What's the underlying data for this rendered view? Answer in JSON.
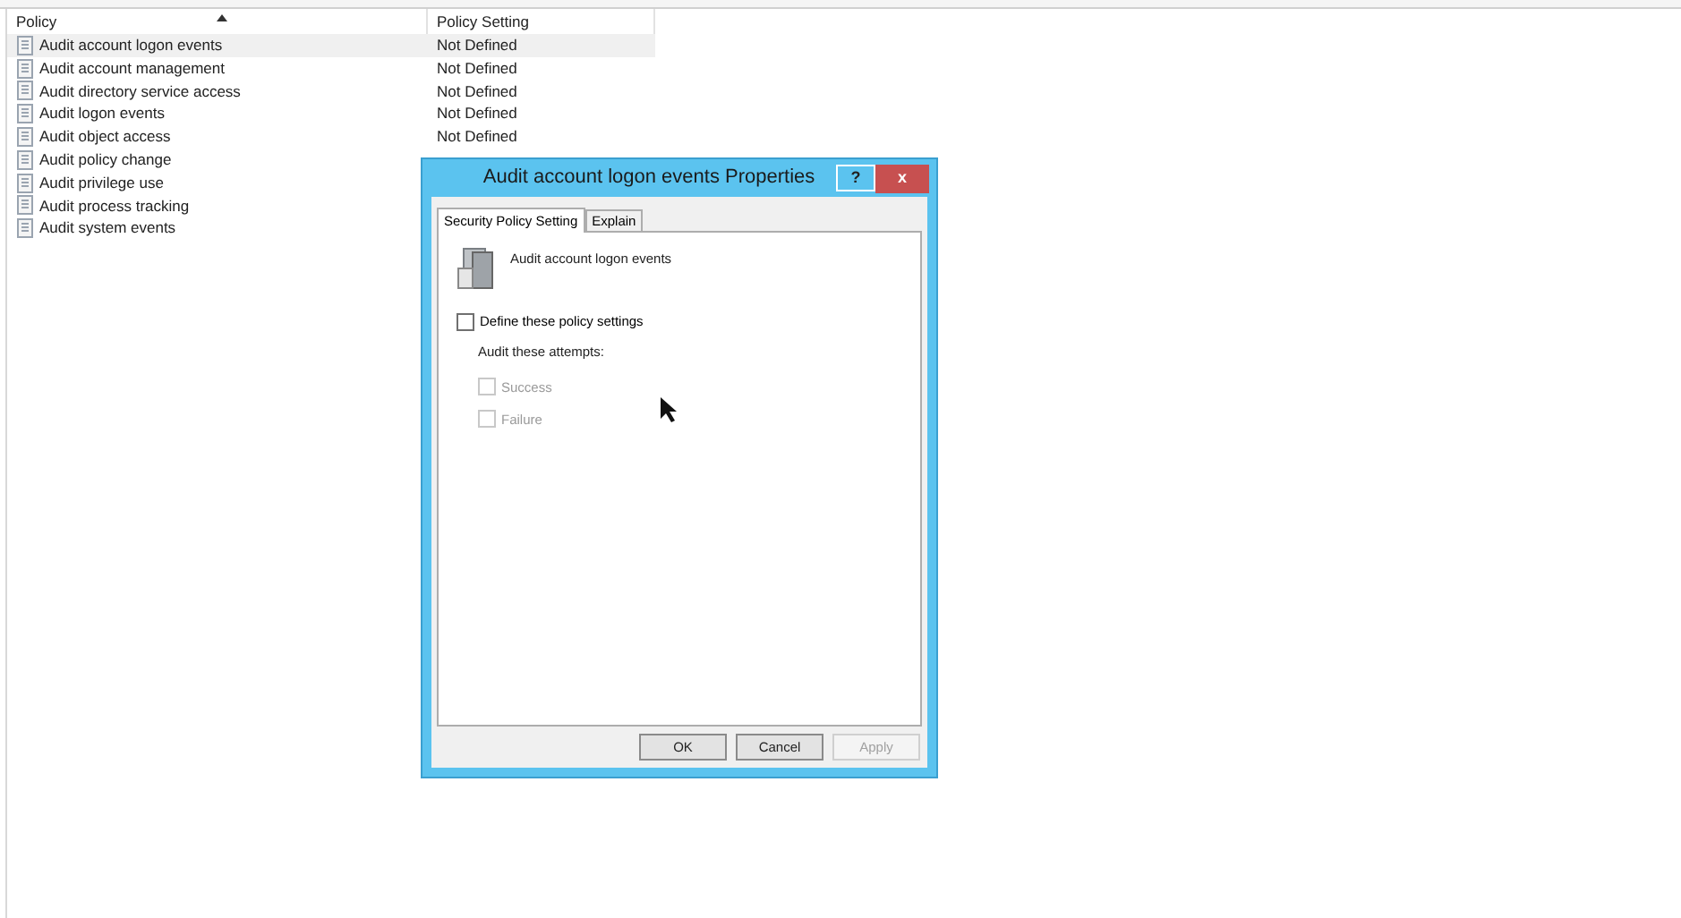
{
  "table": {
    "columns": [
      {
        "label": "Policy",
        "sorted": true
      },
      {
        "label": "Policy Setting",
        "sorted": false
      }
    ],
    "rows": [
      {
        "policy": "Audit account logon events",
        "setting": "Not Defined",
        "selected": true
      },
      {
        "policy": "Audit account management",
        "setting": "Not Defined",
        "selected": false
      },
      {
        "policy": "Audit directory service access",
        "setting": "Not Defined",
        "selected": false
      },
      {
        "policy": "Audit logon events",
        "setting": "Not Defined",
        "selected": false
      },
      {
        "policy": "Audit object access",
        "setting": "Not Defined",
        "selected": false
      },
      {
        "policy": "Audit policy change",
        "selected": false
      },
      {
        "policy": "Audit privilege use",
        "selected": false
      },
      {
        "policy": "Audit process tracking",
        "selected": false
      },
      {
        "policy": "Audit system events",
        "selected": false
      }
    ]
  },
  "dialog": {
    "title": "Audit account logon events Properties",
    "help": "?",
    "close": "x",
    "tabs": [
      {
        "label": "Security Policy Setting",
        "selected": true
      },
      {
        "label": "Explain",
        "selected": false
      }
    ],
    "policy_name": "Audit account logon events",
    "define": {
      "label": "Define these policy settings",
      "checked": false,
      "disabled": false
    },
    "attempts_label": "Audit these attempts:",
    "attempts": [
      {
        "label": "Success",
        "checked": false,
        "disabled": true
      },
      {
        "label": "Failure",
        "checked": false,
        "disabled": true
      }
    ],
    "buttons": [
      {
        "label": "OK",
        "disabled": false
      },
      {
        "label": "Cancel",
        "disabled": false
      },
      {
        "label": "Apply",
        "disabled": true
      }
    ]
  }
}
